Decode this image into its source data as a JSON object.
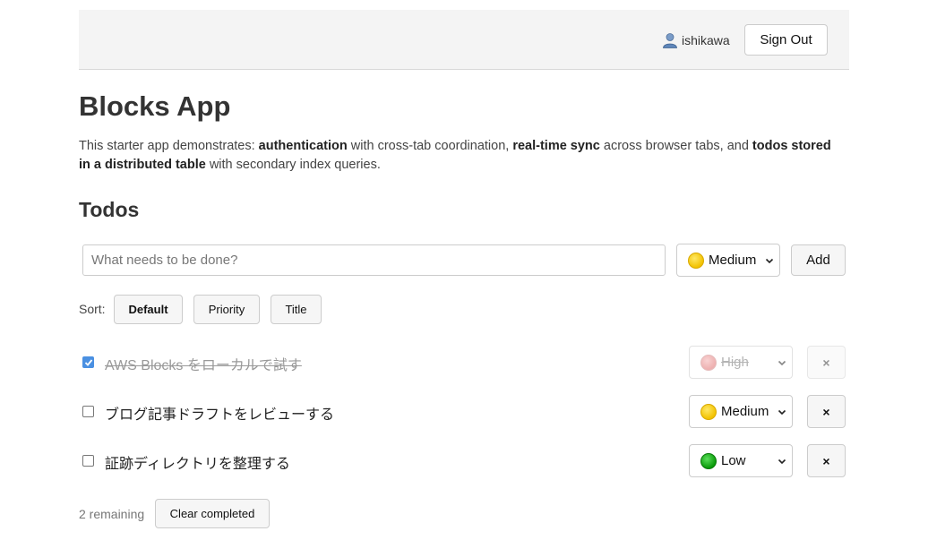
{
  "header": {
    "username": "ishikawa",
    "user_icon": "user-icon",
    "sign_out_label": "Sign Out"
  },
  "page": {
    "title": "Blocks App",
    "intro": {
      "t1": "This starter app demonstrates: ",
      "b1": "authentication",
      "t2": " with cross-tab coordination, ",
      "b2": "real-time sync",
      "t3": " across browser tabs, and ",
      "b3": "todos stored in a distributed table",
      "t4": " with secondary index queries."
    },
    "section_title": "Todos"
  },
  "new_todo": {
    "placeholder": "What needs to be done?",
    "value": "",
    "priority": "Medium",
    "priority_color": "#f2c200",
    "add_label": "Add"
  },
  "sort": {
    "label": "Sort:",
    "options": [
      "Default",
      "Priority",
      "Title"
    ],
    "active": "Default"
  },
  "todos": [
    {
      "title": "AWS Blocks をローカルで試す",
      "completed": true,
      "priority": "High",
      "priority_color": "#e07070",
      "delete_label": "×"
    },
    {
      "title": "ブログ記事ドラフトをレビューする",
      "completed": false,
      "priority": "Medium",
      "priority_color": "#f2c200",
      "delete_label": "×"
    },
    {
      "title": "証跡ディレクトリを整理する",
      "completed": false,
      "priority": "Low",
      "priority_color": "#0a9a0a",
      "delete_label": "×"
    }
  ],
  "footer": {
    "remaining_text": "2 remaining",
    "clear_label": "Clear completed"
  }
}
